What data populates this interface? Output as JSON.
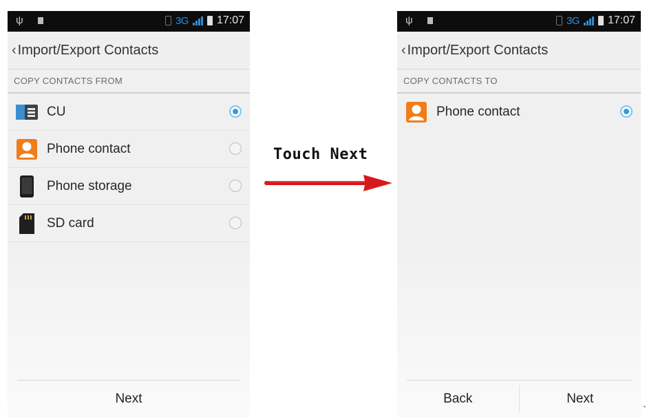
{
  "annotation": {
    "text": "Touch Next",
    "arrow_color": "#d8191c"
  },
  "left_screen": {
    "status": {
      "network": "3G",
      "time": "17:07"
    },
    "title": "Import/Export Contacts",
    "section_header": "COPY CONTACTS FROM",
    "items": [
      {
        "label": "CU",
        "icon": "sim-card-icon",
        "checked": true
      },
      {
        "label": "Phone contact",
        "icon": "contact-person-icon",
        "checked": false
      },
      {
        "label": "Phone storage",
        "icon": "phone-storage-icon",
        "checked": false
      },
      {
        "label": "SD card",
        "icon": "sd-card-icon",
        "checked": false
      }
    ],
    "buttons": {
      "next": "Next"
    }
  },
  "right_screen": {
    "status": {
      "network": "3G",
      "time": "17:07"
    },
    "title": "Import/Export Contacts",
    "section_header": "COPY CONTACTS TO",
    "items": [
      {
        "label": "Phone contact",
        "icon": "contact-person-icon",
        "checked": true
      }
    ],
    "buttons": {
      "back": "Back",
      "next": "Next"
    }
  },
  "colors": {
    "radio_selected": "#2a9ee0",
    "contact_icon": "#f07c1a",
    "status_network": "#2b8fd6"
  }
}
